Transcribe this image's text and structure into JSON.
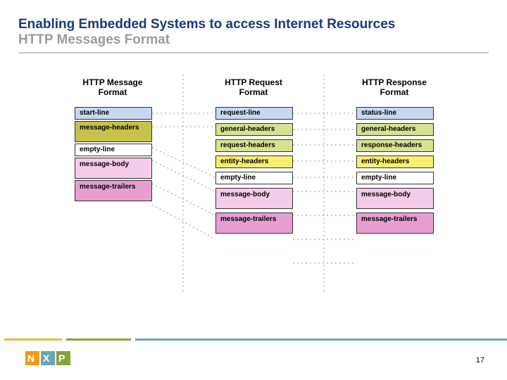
{
  "title": {
    "line1": "Enabling Embedded Systems to access Internet Resources",
    "line2": "HTTP Messages Format"
  },
  "columns": [
    {
      "header_l1": "HTTP Message",
      "header_l2": "Format"
    },
    {
      "header_l1": "HTTP Request",
      "header_l2": "Format"
    },
    {
      "header_l1": "HTTP Response",
      "header_l2": "Format"
    }
  ],
  "col1_cells": [
    {
      "label": "start-line",
      "color": "c-blue",
      "size": "short"
    },
    {
      "label": "message-headers",
      "color": "c-olive",
      "size": "tall"
    },
    {
      "label": "empty-line",
      "color": "c-white",
      "size": "short"
    },
    {
      "label": "message-body",
      "color": "c-pink",
      "size": "tall"
    },
    {
      "label": "message-trailers",
      "color": "c-magenta",
      "size": "tall"
    }
  ],
  "col2_cells": [
    {
      "label": "request-line",
      "color": "c-blue",
      "size": "short"
    },
    {
      "label": "general-headers",
      "color": "c-greenish",
      "size": "short"
    },
    {
      "label": "request-headers",
      "color": "c-greenish",
      "size": "short"
    },
    {
      "label": "entity-headers",
      "color": "c-yellow",
      "size": "short"
    },
    {
      "label": "empty-line",
      "color": "c-white",
      "size": "short"
    },
    {
      "label": "message-body",
      "color": "c-pink",
      "size": "tall"
    },
    {
      "label": "message-trailers",
      "color": "c-magenta",
      "size": "tall"
    }
  ],
  "col3_cells": [
    {
      "label": "status-line",
      "color": "c-blue",
      "size": "short"
    },
    {
      "label": "general-headers",
      "color": "c-greenish",
      "size": "short"
    },
    {
      "label": "response-headers",
      "color": "c-greenish",
      "size": "short"
    },
    {
      "label": "entity-headers",
      "color": "c-yellow",
      "size": "short"
    },
    {
      "label": "empty-line",
      "color": "c-white",
      "size": "short"
    },
    {
      "label": "message-body",
      "color": "c-pink",
      "size": "tall"
    },
    {
      "label": "message-trailers",
      "color": "c-magenta",
      "size": "tall"
    }
  ],
  "page_number": "17"
}
